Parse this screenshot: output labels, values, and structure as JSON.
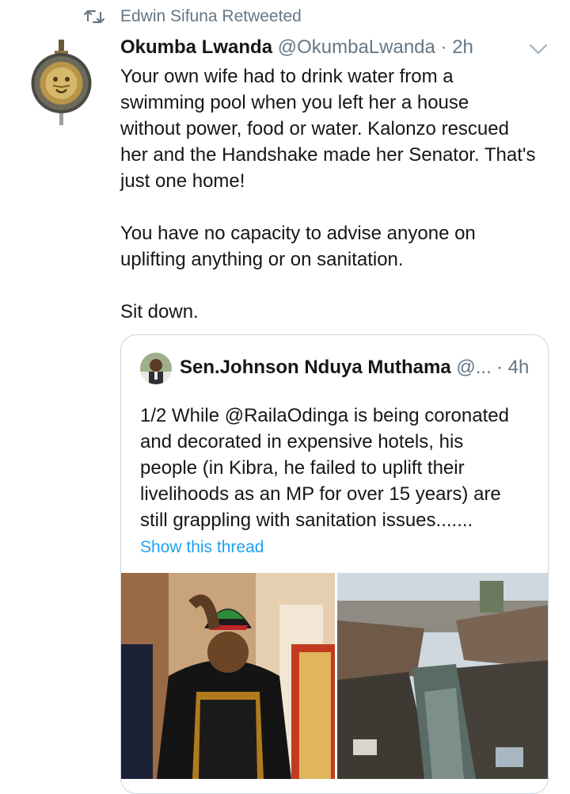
{
  "retweet": {
    "icon": "retweet-icon",
    "label": "Edwin Sifuna Retweeted"
  },
  "tweet": {
    "author_name": "Okumba Lwanda",
    "handle": "@OkumbaLwanda",
    "separator": "·",
    "time": "2h",
    "avatar_icon": "lion-shield-emblem",
    "menu_icon": "chevron-down-icon",
    "paragraphs": [
      "Your own wife had to drink water from a\nswimming pool when you left her a house\nwithout power, food or water. Kalonzo rescued\nher and the Handshake made her Senator. That's\njust one home!",
      "You have no capacity to advise anyone on\nuplifting anything or on sanitation.",
      "Sit down."
    ]
  },
  "quoted": {
    "author_name": "Sen.Johnson Nduya Muthama",
    "handle": "@...",
    "separator": "·",
    "time": "4h",
    "text": "1/2 While @RailaOdinga is being coronated\nand decorated in expensive hotels, his\npeople (in Kibra, he failed to uplift their\nlivelihoods as an MP for over 15 years) are\nstill grappling with sanitation issues.......",
    "show_thread": "Show this thread",
    "images": [
      {
        "name": "coronation-photo"
      },
      {
        "name": "sanitation-slum-photo"
      }
    ]
  },
  "colors": {
    "link": "#1da1f2",
    "secondary": "#657786",
    "border": "#ccd6dd"
  }
}
